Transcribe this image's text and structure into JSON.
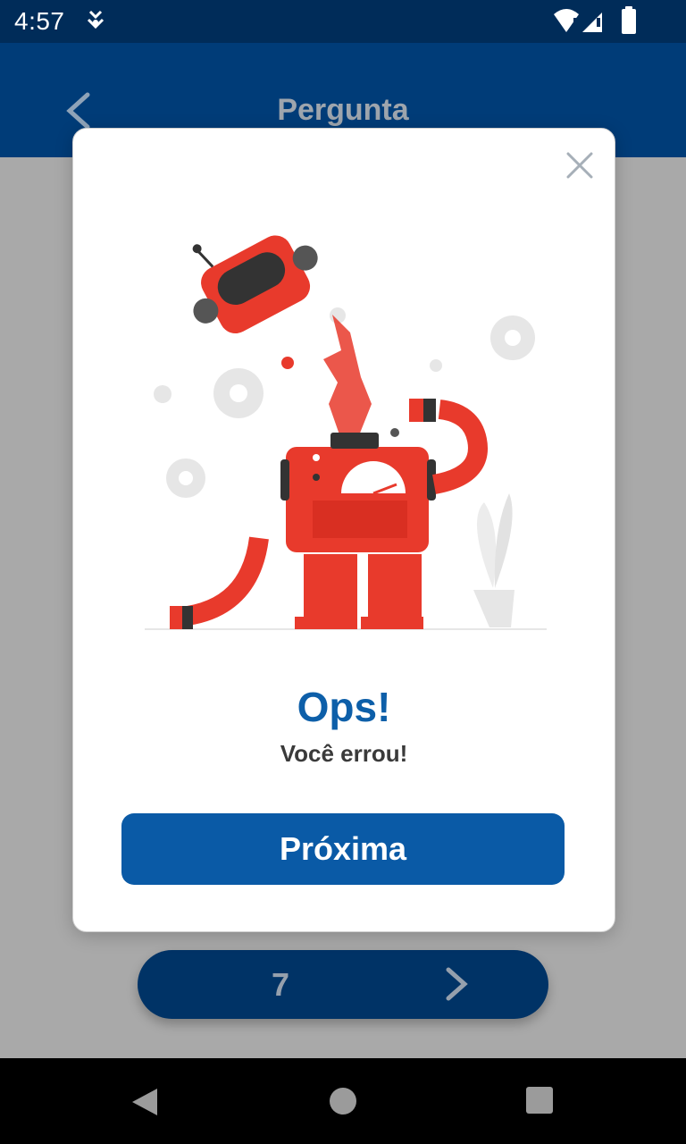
{
  "status_bar": {
    "time": "4:57",
    "icons": [
      "download-icon",
      "wifi-icon",
      "signal-icon",
      "battery-icon"
    ]
  },
  "app_bar": {
    "title": "Pergunta",
    "back_icon": "chevron-left-icon"
  },
  "pager": {
    "number": "7",
    "next_icon": "chevron-right-icon"
  },
  "dialog": {
    "title": "Ops!",
    "message": "Você errou!",
    "button_label": "Próxima",
    "close_icon": "close-icon",
    "illustration": "broken-robot-illustration"
  },
  "nav_bar": {
    "icons": [
      "back-triangle-icon",
      "home-circle-icon",
      "recents-square-icon"
    ]
  },
  "colors": {
    "status_bar": "#002c59",
    "app_bar": "#003c78",
    "overlay": "#a9a9a9",
    "accent": "#0a5aa6",
    "title": "#0d5fa9",
    "robot_red": "#e83a2c"
  }
}
